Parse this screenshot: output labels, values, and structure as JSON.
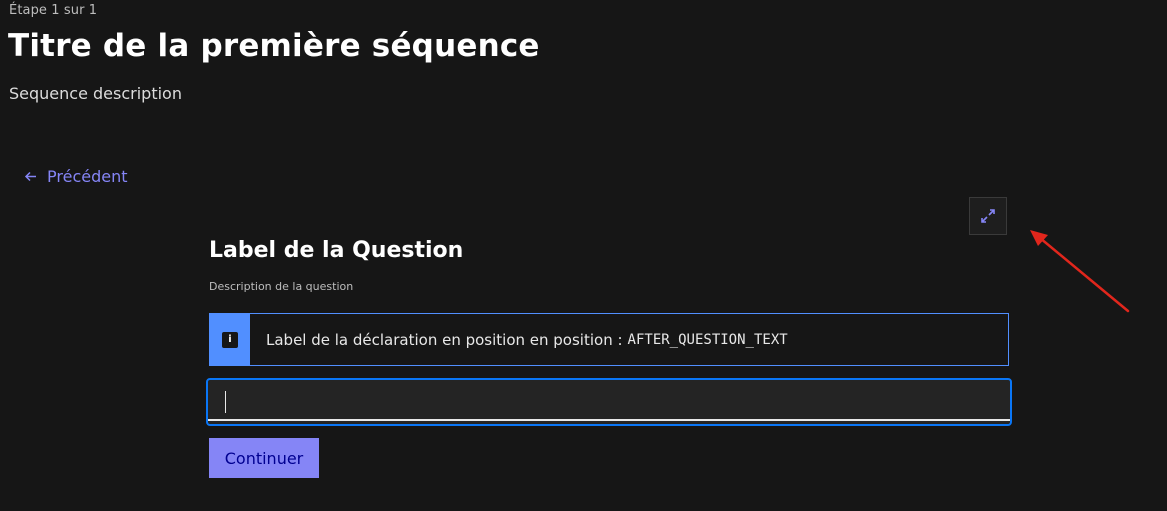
{
  "stepper": {
    "step_label": "Étape 1 sur 1"
  },
  "sequence": {
    "title": "Titre de la première séquence",
    "description": "Sequence description"
  },
  "navigation": {
    "back_label": "Précédent",
    "back_icon": "arrow-left-icon"
  },
  "toolbar": {
    "expand_icon": "expand-icon"
  },
  "question": {
    "label": "Label de la Question",
    "description": "Description de la question",
    "declaration": {
      "icon": "info-icon",
      "icon_glyph": "i",
      "text": "Label de la déclaration en position en position :",
      "code": "AFTER_QUESTION_TEXT"
    },
    "input": {
      "value": "",
      "placeholder": ""
    }
  },
  "actions": {
    "continue_label": "Continuer"
  },
  "colors": {
    "background": "#161616",
    "accent": "#8585f6",
    "info": "#518fff",
    "focus": "#0a76f6",
    "button_text": "#000091",
    "annotation": "#e1261c"
  }
}
